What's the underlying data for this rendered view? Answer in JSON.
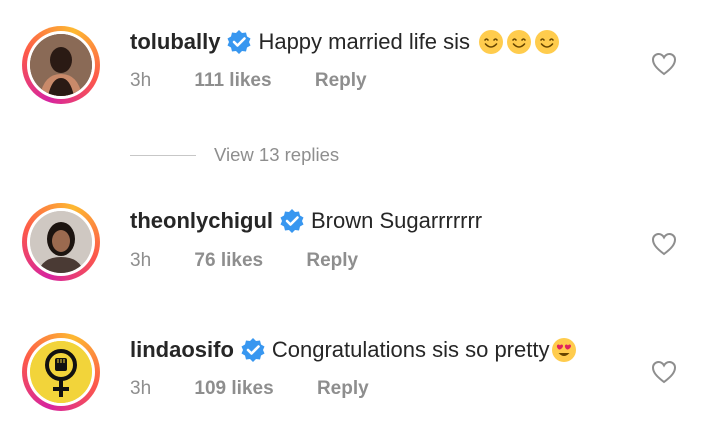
{
  "comments": [
    {
      "username": "tolubally",
      "text": "Happy married life sis",
      "emojis": [
        "smiling-face-icon",
        "smiling-face-icon",
        "smiling-face-icon"
      ],
      "time": "3h",
      "likes": "111 likes",
      "reply": "Reply",
      "verified": true
    },
    {
      "username": "theonlychigul",
      "text": "Brown Sugarrrrrrr",
      "emojis": [],
      "time": "3h",
      "likes": "76 likes",
      "reply": "Reply",
      "verified": true
    },
    {
      "username": "lindaosifo",
      "text": "Congratulations sis so pretty",
      "emojis": [
        "heart-eyes-face-icon"
      ],
      "time": "3h",
      "likes": "109 likes",
      "reply": "Reply",
      "verified": true
    }
  ],
  "view_replies": "View 13 replies",
  "colors": {
    "verified": "#3897f0",
    "muted": "#8e8e8e",
    "text": "#262626",
    "emoji": "#ffcc4d"
  }
}
